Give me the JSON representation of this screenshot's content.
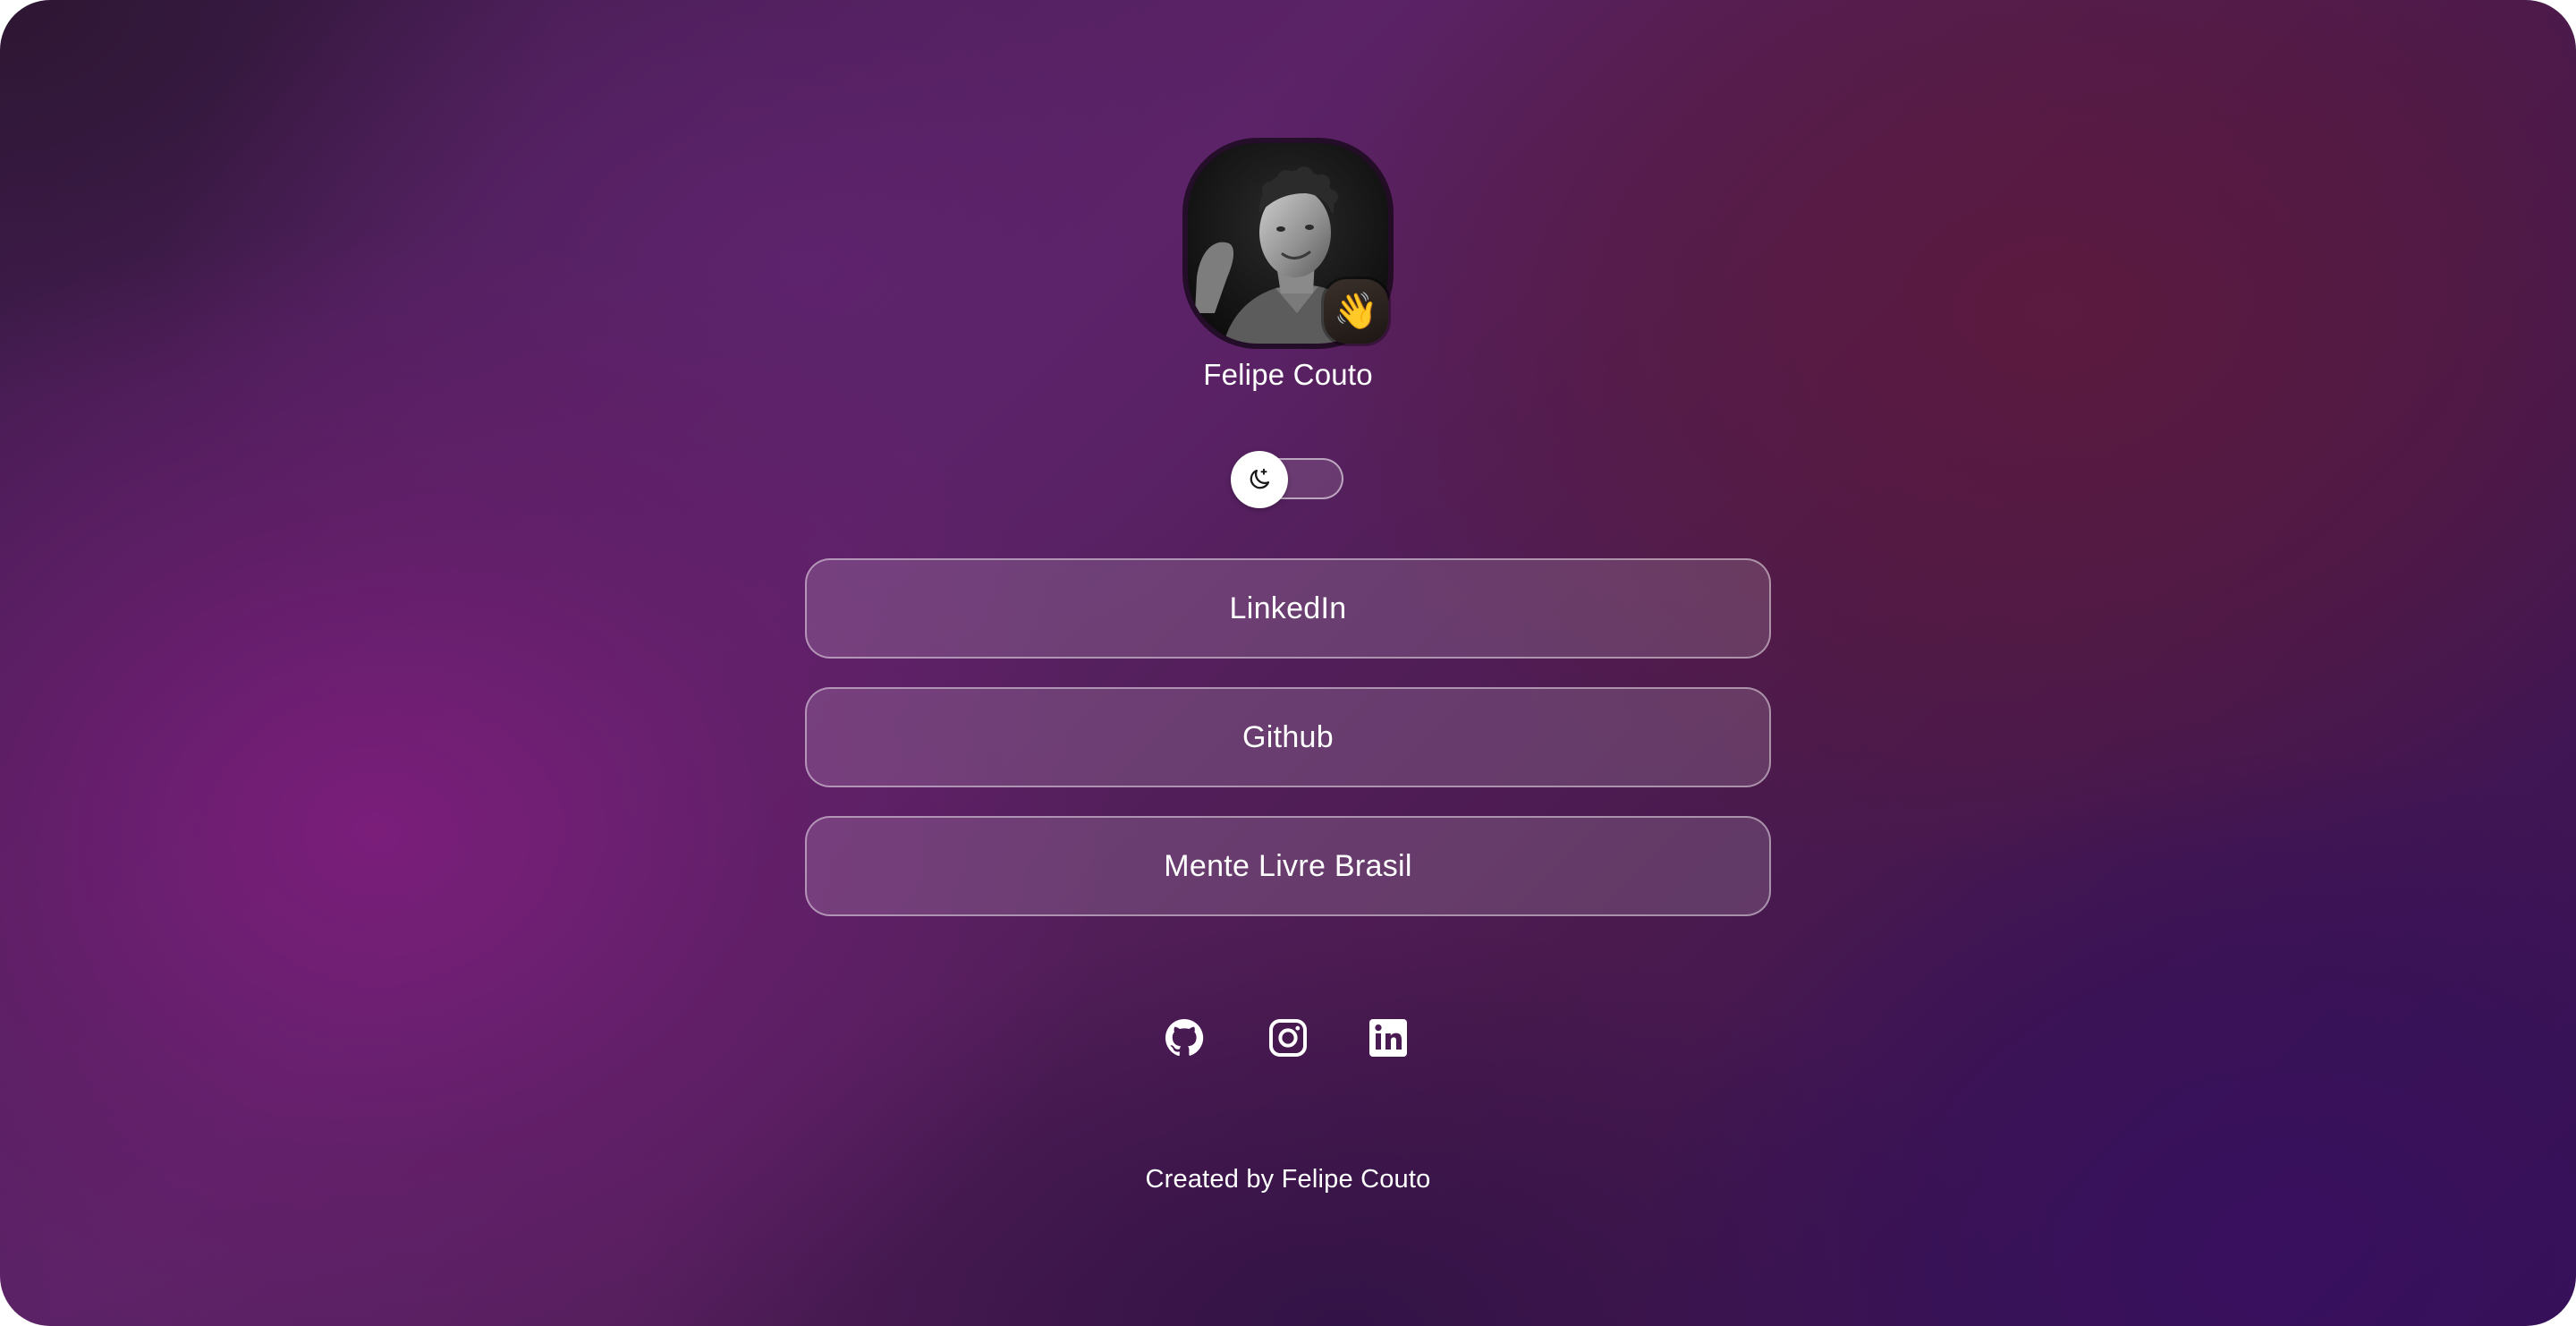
{
  "profile": {
    "name": "Felipe Couto",
    "badge_emoji": "👋",
    "avatar_icon": "profile-photo"
  },
  "theme_toggle": {
    "icon": "moon-icon",
    "state": "dark"
  },
  "links": [
    {
      "label": "LinkedIn"
    },
    {
      "label": "Github"
    },
    {
      "label": "Mente Livre Brasil"
    }
  ],
  "socials": [
    {
      "icon": "github-icon"
    },
    {
      "icon": "instagram-icon"
    },
    {
      "icon": "linkedin-icon"
    }
  ],
  "footer": {
    "text": "Created by Felipe Couto"
  },
  "colors": {
    "accent_purple": "#7a1f7c",
    "deep_purple": "#3a1258",
    "wine": "#5a1a3c",
    "text": "#ffffff"
  }
}
